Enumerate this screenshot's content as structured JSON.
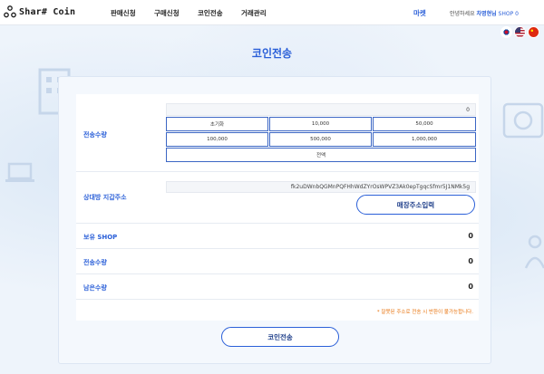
{
  "header": {
    "logo_text": "Shar# Coin",
    "nav": [
      "판매신청",
      "구매신청",
      "코인전송",
      "거래관리"
    ],
    "market": "마켓",
    "greeting_prefix": "안녕하세요",
    "user_name": "차명현님",
    "shop_label": "SHOP 0",
    "flags": [
      "korea-flag",
      "usa-flag",
      "china-flag"
    ]
  },
  "page": {
    "title": "코인전송"
  },
  "form": {
    "amount_label": "전송수량",
    "amount_value": "0",
    "quick_amounts": [
      "초기화",
      "10,000",
      "50,000",
      "100,000",
      "500,000",
      "1,000,000",
      "전액"
    ],
    "address_label": "상대방 지갑주소",
    "address_value": "fk2uDWnbQGMnPQFHhWdZYrOsWPVZ3Ak0epTgqcSfmr5J1NMk5g",
    "address_button": "매장주소입력",
    "holding_label": "보유 SHOP",
    "holding_value": "0",
    "send_amount_label": "전송수량",
    "send_amount_value": "0",
    "remaining_label": "남은수량",
    "remaining_value": "0",
    "warning": "* 잘못된 주소로 전송 시 반환이 불가능합니다.",
    "submit_button": "코인전송"
  },
  "colors": {
    "accent": "#2a5fd8",
    "warning": "#e8730c",
    "panel_bg": "#f4f8fd"
  }
}
